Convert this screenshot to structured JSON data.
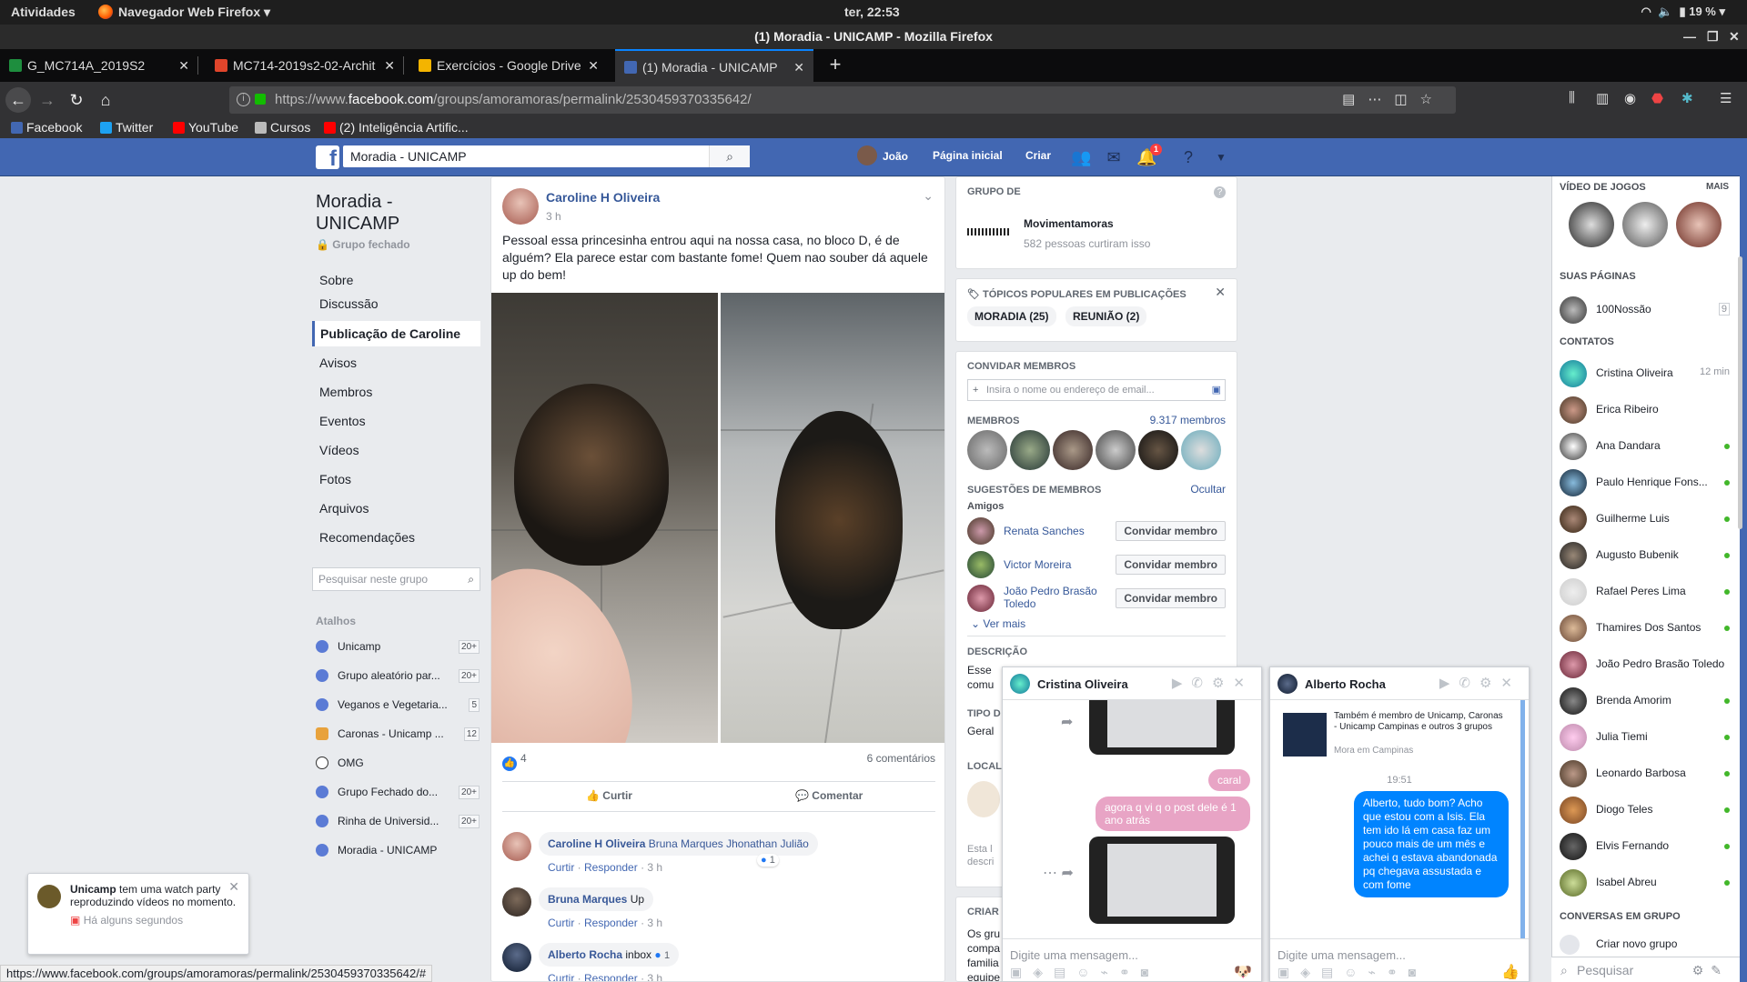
{
  "system_bar": {
    "activities": "Atividades",
    "app_menu": "Navegador Web Firefox",
    "clock": "ter, 22:53",
    "battery": "19 %"
  },
  "window": {
    "title": "(1) Moradia - UNICAMP - Mozilla Firefox"
  },
  "tabs": [
    {
      "label": "G_MC714A_2019S2",
      "icon_color": "#1e8e3e"
    },
    {
      "label": "MC714-2019s2-02-Archit",
      "icon_color": "#e0452b"
    },
    {
      "label": "Exercícios - Google Drive",
      "icon_color": "#f4b400"
    },
    {
      "label": "(1) Moradia - UNICAMP",
      "icon_color": "#4267b2"
    }
  ],
  "urlbar": {
    "prefix": "https://www.",
    "host": "facebook.com",
    "path": "/groups/amoramoras/permalink/2530459370335642/"
  },
  "bookmarks": [
    {
      "label": "Facebook",
      "icon_color": "#4267b2"
    },
    {
      "label": "Twitter",
      "icon_color": "#1da1f2"
    },
    {
      "label": "YouTube",
      "icon_color": "#ff0000"
    },
    {
      "label": "Cursos",
      "icon_color": "#bbbbbb"
    },
    {
      "label": "(2) Inteligência Artific...",
      "icon_color": "#ff0000"
    }
  ],
  "fb_header": {
    "search_value": "Moradia - UNICAMP",
    "user_name": "João",
    "home": "Página inicial",
    "create": "Criar",
    "notif_count": "1"
  },
  "group": {
    "title": "Moradia - UNICAMP",
    "privacy": "Grupo fechado",
    "nav": [
      "Sobre",
      "Discussão",
      "Publicação de Caroline",
      "Avisos",
      "Membros",
      "Eventos",
      "Vídeos",
      "Fotos",
      "Arquivos",
      "Recomendações"
    ],
    "search_placeholder": "Pesquisar neste grupo",
    "shortcuts_heading": "Atalhos",
    "shortcuts": [
      {
        "label": "Unicamp",
        "badge": "20+"
      },
      {
        "label": "Grupo aleatório par...",
        "badge": "20+"
      },
      {
        "label": "Veganos e Vegetaria...",
        "badge": "5"
      },
      {
        "label": "Caronas - Unicamp ...",
        "badge": "12"
      },
      {
        "label": "OMG",
        "badge": ""
      },
      {
        "label": "Grupo Fechado do...",
        "badge": "20+"
      },
      {
        "label": "Rinha de Universid...",
        "badge": "20+"
      },
      {
        "label": "Moradia - UNICAMP",
        "badge": ""
      }
    ]
  },
  "watch_popup": {
    "name": "Unicamp",
    "text": "tem uma watch party reproduzindo vídeos no momento.",
    "time": "Há alguns segundos"
  },
  "post": {
    "author": "Caroline H Oliveira",
    "time": "3 h",
    "text": "Pessoal essa princesinha entrou aqui na nossa casa, no bloco D, é de alguém? Ela parece estar com bastante fome! Quem nao souber dá aquele up do bem!",
    "likes": "4",
    "comments_count": "6 comentários",
    "like_label": "Curtir",
    "comment_label": "Comentar",
    "comments": [
      {
        "author": "Caroline H Oliveira",
        "text": "Bruna Marques Jhonathan Julião",
        "react": "1",
        "actions": [
          "Curtir",
          "Responder"
        ],
        "time": "3 h"
      },
      {
        "author": "Bruna Marques",
        "text": "Up",
        "react": "",
        "actions": [
          "Curtir",
          "Responder"
        ],
        "time": "3 h"
      },
      {
        "author": "Alberto Rocha",
        "text": "inbox",
        "react": "1",
        "actions": [
          "Curtir",
          "Responder"
        ],
        "time": "3 h"
      }
    ]
  },
  "right": {
    "group_of_heading": "Grupo de",
    "page_name": "Movimentamoras",
    "page_likes": "582 pessoas curtiram isso",
    "topics_heading": "Tópicos populares em publicações",
    "topics": [
      "MORADIA (25)",
      "REUNIÃO (2)"
    ],
    "invite_heading": "Convidar membros",
    "invite_placeholder": "Insira o nome ou endereço de email...",
    "members_heading": "Membros",
    "members_count": "9.317 membros",
    "suggestions_heading": "Sugestões de membros",
    "hide": "Ocultar",
    "friends": "Amigos",
    "suggestions": [
      {
        "name": "Renata Sanches",
        "button": "Convidar membro"
      },
      {
        "name": "Victor Moreira",
        "button": "Convidar membro"
      },
      {
        "name": "João Pedro Brasão Toledo",
        "button": "Convidar membro"
      }
    ],
    "see_more": "Ver mais",
    "description_heading": "Descrição",
    "description_text": "Esse comu",
    "type_heading": "Tipo d",
    "type_value": "Geral",
    "location_heading": "Locali",
    "location_text": "Esta l descri",
    "created_heading": "Criar",
    "created_text": "Os gru compa familia equipe"
  },
  "chats": [
    {
      "name": "Cristina Oliveira",
      "messages": [
        "caral",
        "agora q vi q o post dele é 1 ano atrás"
      ],
      "input_placeholder": "Digite uma mensagem..."
    },
    {
      "name": "Alberto Rocha",
      "info": "Também é membro de Unicamp, Caronas - Unicamp Campinas e outros 3 grupos",
      "location": "Mora em Campinas",
      "time": "19:51",
      "message": "Alberto, tudo bom? Acho que estou com a Isis. Ela tem ido lá em casa faz um pouco mais de um mês e achei q estava abandonada pq chegava assustada e com fome",
      "input_placeholder": "Digite uma mensagem..."
    }
  ],
  "sidebar": {
    "games_heading": "Vídeo de jogos",
    "games_more": "MAIS",
    "pages_heading": "Suas páginas",
    "page": {
      "name": "100Nossão",
      "badge": "9"
    },
    "contacts_heading": "Contatos",
    "contacts": [
      {
        "name": "Cristina Oliveira",
        "status": "12 min"
      },
      {
        "name": "Erica Ribeiro",
        "status": ""
      },
      {
        "name": "Ana Dandara",
        "status": "online"
      },
      {
        "name": "Paulo Henrique Fons...",
        "status": "online"
      },
      {
        "name": "Guilherme Luis",
        "status": "online"
      },
      {
        "name": "Augusto Bubenik",
        "status": "online"
      },
      {
        "name": "Rafael Peres Lima",
        "status": "online"
      },
      {
        "name": "Thamires Dos Santos",
        "status": "online"
      },
      {
        "name": "João Pedro Brasão Toledo",
        "status": ""
      },
      {
        "name": "Brenda Amorim",
        "status": "online"
      },
      {
        "name": "Julia Tiemi",
        "status": "online"
      },
      {
        "name": "Leonardo Barbosa",
        "status": "online"
      },
      {
        "name": "Diogo Teles",
        "status": "online"
      },
      {
        "name": "Elvis Fernando",
        "status": "online"
      },
      {
        "name": "Isabel Abreu",
        "status": "online"
      }
    ],
    "group_chats_heading": "Conversas em grupo",
    "create_group": "Criar novo grupo",
    "search_placeholder": "Pesquisar"
  },
  "status_url": "https://www.facebook.com/groups/amoramoras/permalink/2530459370335642/#"
}
